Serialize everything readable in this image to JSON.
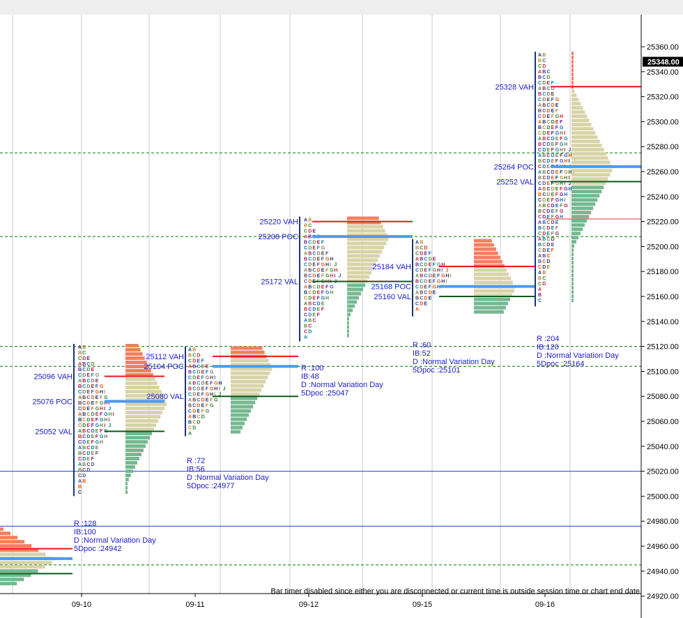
{
  "status_message": "Bar timer disabled since either you are disconnected or current time is outside session time or chart end date",
  "chart_data": {
    "type": "market-profile",
    "title": "",
    "xlabel": "",
    "ylabel": "",
    "ylim": [
      24915,
      25375
    ],
    "grid": true,
    "y_ticks": [
      "25360.00",
      "25340.00",
      "25320.00",
      "25300.00",
      "25280.00",
      "25260.00",
      "25240.00",
      "25220.00",
      "25200.00",
      "25180.00",
      "25160.00",
      "25140.00",
      "25120.00",
      "25100.00",
      "25080.00",
      "25060.00",
      "25040.00",
      "25020.00",
      "25000.00",
      "24980.00",
      "24960.00",
      "24940.00",
      "24920.00"
    ],
    "current_price_label": "25348.00",
    "current_price": 25348,
    "date_labels": [
      "09-10",
      "09-11",
      "09-12",
      "09-15",
      "09-16"
    ],
    "sessions": [
      {
        "date": "",
        "high": 24975,
        "low": 24922,
        "vah": null,
        "poc": 24950,
        "val": null,
        "vah_label": "",
        "poc_label": "",
        "val_label": "",
        "stats": [
          "R :128",
          "IB:100",
          "D :Normal Variation Day",
          "5Dpoc :24942"
        ],
        "hvn_dashed": [
          24945
        ]
      },
      {
        "date": "09-10",
        "high": 25122,
        "low": 25000,
        "vah": 25096,
        "poc": 25076,
        "val": 25052,
        "vah_label": "25096 VAH",
        "poc_label": "25076 POC",
        "val_label": "25052 VAL",
        "stats": [
          "R :72",
          "IB:56",
          "D :Normal Variation Day",
          "5Dpoc :24977"
        ]
      },
      {
        "date": "09-11",
        "high": 25120,
        "low": 25048,
        "vah": 25112,
        "poc": 25104,
        "val": 25080,
        "vah_label": "25112 VAH",
        "poc_label": "25104 POC",
        "val_label": "25080 VAL",
        "stats": [
          "R :100",
          "IB:48",
          "D :Normal Variation Day",
          "5Dpoc :25047"
        ]
      },
      {
        "date": "09-12",
        "high": 25224,
        "low": 25124,
        "vah": 25220,
        "poc": 25208,
        "val": 25172,
        "vah_label": "25220 VAH",
        "poc_label": "25208 POC",
        "val_label": "25172 VAL",
        "stats": [
          "R :60",
          "IB:52",
          "D :Normal Variation Day",
          "5Dpoc :25101"
        ]
      },
      {
        "date": "09-15",
        "high": 25206,
        "low": 25144,
        "vah": 25184,
        "poc": 25168,
        "val": 25160,
        "vah_label": "25184 VAH",
        "poc_label": "25168 POC",
        "val_label": "25160 VAL",
        "stats": [
          "R :204",
          "IB:120",
          "D :Normal Variation Day",
          "5Dpoc :25164"
        ]
      },
      {
        "date": "09-16",
        "high": 25356,
        "low": 25152,
        "vah": 25328,
        "poc": 25264,
        "val": 25252,
        "vah_label": "25328 VAH",
        "poc_label": "25264 POC",
        "val_label": "25252 VAL",
        "stats": []
      }
    ],
    "reference_lines": [
      {
        "price": 25275,
        "style": "dashed",
        "color": "#007700"
      },
      {
        "price": 25120,
        "style": "dashed",
        "color": "#007700"
      },
      {
        "price": 25104,
        "style": "dashed",
        "color": "#007700"
      },
      {
        "price": 25208,
        "style": "dashed",
        "color": "#007700"
      },
      {
        "price": 24945,
        "style": "dashed",
        "color": "#007700"
      },
      {
        "price": 25020,
        "style": "solid",
        "color": "#1f3fd6"
      },
      {
        "price": 24976,
        "style": "solid",
        "color": "#1f3fd6"
      },
      {
        "price": 25222,
        "style": "solid",
        "color": "#e0333a"
      }
    ],
    "colors": {
      "vah_line": "#e8151b",
      "poc_line": "#4a9bf2",
      "val_line": "#0a5a1a",
      "label_text": "#1b1bcc",
      "profile_upper": "#f08060",
      "profile_mid": "#d8d3a8",
      "profile_lower": "#74b890",
      "grid": "#c8c8c8",
      "tpo_bar": "#17347a"
    }
  }
}
